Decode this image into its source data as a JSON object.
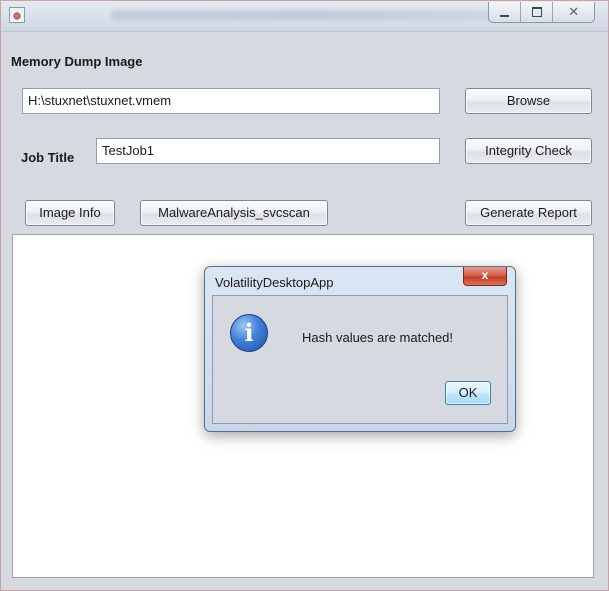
{
  "main": {
    "memory_dump_label": "Memory Dump Image",
    "memory_dump_path": "H:\\stuxnet\\stuxnet.vmem",
    "browse_label": "Browse",
    "job_title_label": "Job Title",
    "job_title_value": "TestJob1",
    "integrity_check_label": "Integrity Check",
    "image_info_label": "Image Info",
    "malware_analysis_label": "MalwareAnalysis_svcscan",
    "generate_report_label": "Generate Report",
    "output_text": ""
  },
  "dialog": {
    "title": "VolatilityDesktopApp",
    "close_glyph": "x",
    "icon": "information-icon",
    "icon_glyph": "i",
    "message": "Hash values are matched!",
    "ok_label": "OK"
  },
  "titlebar": {
    "icon": "java-app-icon",
    "minimize_icon": "minimize-icon",
    "maximize_icon": "maximize-icon",
    "close_icon": "close-icon",
    "close_glyph": "✕"
  },
  "colors": {
    "window_bg": "#d6d9df",
    "dialog_close_red": "#c23c26",
    "info_icon_blue": "#3f7fd8",
    "ok_button_blue": "#bee6fd"
  }
}
